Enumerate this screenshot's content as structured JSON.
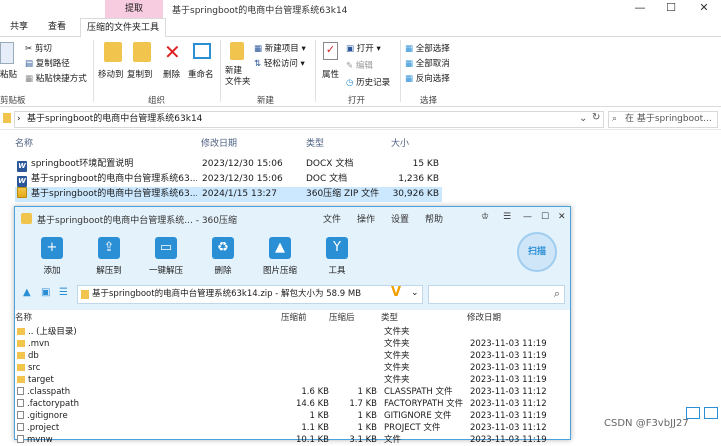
{
  "window": {
    "context_tab": "提取",
    "title": "基于springboot的电商中台管理系统63k14"
  },
  "tabs": [
    "共享",
    "查看",
    "压缩的文件夹工具"
  ],
  "ribbon": {
    "paste": "粘贴",
    "cut": "剪切",
    "copy_path": "复制路径",
    "paste_shortcut": "粘贴快捷方式",
    "move_to": "移动到",
    "copy_to": "复制到",
    "delete": "删除",
    "rename": "重命名",
    "new_folder": "新建\n文件夹",
    "new_item": "新建项目",
    "easy_access": "轻松访问",
    "properties": "属性",
    "open": "打开",
    "edit": "编辑",
    "history": "历史记录",
    "select_all": "全部选择",
    "select_none": "全部取消",
    "invert": "反向选择",
    "groups": {
      "clipboard": "剪贴板",
      "organize": "组织",
      "new": "新建",
      "open": "打开",
      "select": "选择"
    }
  },
  "address": {
    "path": "基于springboot的电商中台管理系统63k14",
    "search_placeholder": "在 基于springboot..."
  },
  "explorer_columns": {
    "name": "名称",
    "date": "修改日期",
    "type": "类型",
    "size": "大小"
  },
  "explorer_files": [
    {
      "name": "springboot环境配置说明",
      "date": "2023/12/30 15:06",
      "type": "DOCX 文档",
      "size": "15 KB",
      "icon": "word"
    },
    {
      "name": "基于springboot的电商中台管理系统63...",
      "date": "2023/12/30 15:06",
      "type": "DOC 文档",
      "size": "1,236 KB",
      "icon": "word"
    },
    {
      "name": "基于springboot的电商中台管理系统63...",
      "date": "2024/1/15 13:27",
      "type": "360压缩 ZIP 文件",
      "size": "30,926 KB",
      "icon": "zip"
    }
  ],
  "zip": {
    "title": "基于springboot的电商中台管理系统... - 360压缩",
    "menu": [
      "文件",
      "操作",
      "设置",
      "帮助"
    ],
    "tools": [
      "添加",
      "解压到",
      "一键解压",
      "删除",
      "图片压缩",
      "工具"
    ],
    "scan": "扫描",
    "path": "基于springboot的电商中台管理系统63k14.zip - 解包大小为 58.9 MB",
    "columns": {
      "name": "名称",
      "before": "压缩前",
      "after": "压缩后",
      "type": "类型",
      "date": "修改日期"
    },
    "rows": [
      {
        "name": ".. (上级目录)",
        "before": "",
        "after": "",
        "type": "文件夹",
        "date": "",
        "folder": true
      },
      {
        "name": ".mvn",
        "before": "",
        "after": "",
        "type": "文件夹",
        "date": "2023-11-03 11:19",
        "folder": true
      },
      {
        "name": "db",
        "before": "",
        "after": "",
        "type": "文件夹",
        "date": "2023-11-03 11:19",
        "folder": true
      },
      {
        "name": "src",
        "before": "",
        "after": "",
        "type": "文件夹",
        "date": "2023-11-03 11:19",
        "folder": true
      },
      {
        "name": "target",
        "before": "",
        "after": "",
        "type": "文件夹",
        "date": "2023-11-03 11:19",
        "folder": true
      },
      {
        "name": ".classpath",
        "before": "1.6 KB",
        "after": "1 KB",
        "type": "CLASSPATH 文件",
        "date": "2023-11-03 11:12",
        "folder": false
      },
      {
        "name": ".factorypath",
        "before": "14.6 KB",
        "after": "1.7 KB",
        "type": "FACTORYPATH 文件",
        "date": "2023-11-03 11:12",
        "folder": false
      },
      {
        "name": ".gitignore",
        "before": "1 KB",
        "after": "1 KB",
        "type": "GITIGNORE 文件",
        "date": "2023-11-03 11:19",
        "folder": false
      },
      {
        "name": ".project",
        "before": "1.1 KB",
        "after": "1 KB",
        "type": "PROJECT 文件",
        "date": "2023-11-03 11:12",
        "folder": false
      },
      {
        "name": "mvnw",
        "before": "10.1 KB",
        "after": "3.1 KB",
        "type": "文件",
        "date": "2023-11-03 11:19",
        "folder": false
      }
    ]
  },
  "watermark": "CSDN @F3vbJJ27"
}
